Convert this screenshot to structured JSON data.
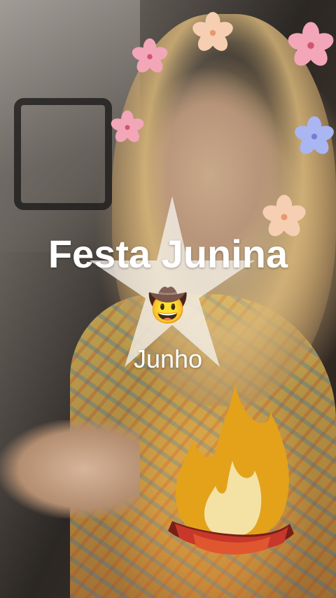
{
  "overlay": {
    "title": "Festa Junina",
    "subtitle": "Junho",
    "emoji": "🤠",
    "star_icon": "star-icon",
    "fire_icon": "campfire-icon",
    "flower_icon": "flower-icon"
  },
  "colors": {
    "text": "#ffffff",
    "star": "#f5f1ea",
    "flame_outer": "#e3a21a",
    "flame_inner": "#f4e2a4",
    "logs": "#c7382a",
    "flower_pink": "#f2a6b8",
    "flower_peach": "#f6cfb2",
    "flower_blue": "#a9b6f2"
  }
}
